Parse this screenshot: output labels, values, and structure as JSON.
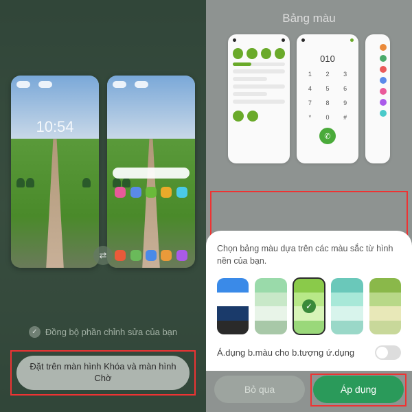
{
  "left": {
    "time": "10:54",
    "sync_label": "Đồng bộ phần chỉnh sửa của bạn",
    "set_button": "Đặt trên màn hình Khóa và màn hình Chờ",
    "home_icons_r1": [
      "#e85a9a",
      "#5a8ae8",
      "#6aba3a",
      "#eaaa2a",
      "#4acae8"
    ],
    "home_icons_r2": [
      "#ea5a3a",
      "#6aba5a",
      "#4a8ae8",
      "#ea9a3a",
      "#aa5ae8"
    ]
  },
  "right": {
    "header": "Bảng màu",
    "dial_display": "010",
    "dial_keys": [
      "1",
      "2",
      "3",
      "4",
      "5",
      "6",
      "7",
      "8",
      "9",
      "*",
      "0",
      "#"
    ],
    "sheet_text": "Chọn bảng màu dựa trên các màu sắc từ hình nền của bạn.",
    "apply_icons_label": "Á.dụng b.màu cho b.tượng ứ.dụng",
    "skip_label": "Bỏ qua",
    "apply_label": "Áp dụng",
    "palettes": [
      {
        "selected": false,
        "colors": [
          "#3a8ae8",
          "#ffffff",
          "#1a3a6a",
          "#2a2a2a"
        ]
      },
      {
        "selected": false,
        "colors": [
          "#9adaaa",
          "#c8e8c8",
          "#e8f4e8",
          "#a8c8a8"
        ]
      },
      {
        "selected": true,
        "colors": [
          "#8aca4a",
          "#b8e888",
          "#d8f4b8",
          "#9ad87a"
        ]
      },
      {
        "selected": false,
        "colors": [
          "#6ac8ba",
          "#a8e8d8",
          "#d8f4ec",
          "#9ad8c8"
        ]
      },
      {
        "selected": false,
        "colors": [
          "#8ab84a",
          "#b8d888",
          "#e8e8b8",
          "#c8d89a"
        ]
      }
    ],
    "color_dots": [
      "#ea8a3a",
      "#4aaa6a",
      "#ea5a5a",
      "#5a8aea",
      "#ea5a9a",
      "#aa5aea",
      "#4acaca"
    ]
  }
}
